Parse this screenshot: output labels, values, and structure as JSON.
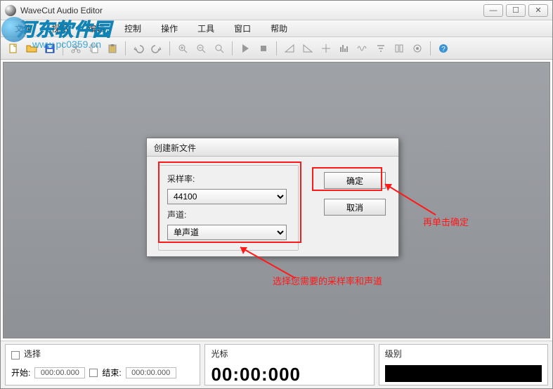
{
  "title": "WaveCut Audio Editor",
  "watermark": {
    "brand_a": "河东",
    "brand_b": "软件园",
    "url": "www.pc0359.cn"
  },
  "menu": [
    "文件",
    "视图",
    "编辑",
    "控制",
    "操作",
    "工具",
    "窗口",
    "帮助"
  ],
  "dialog": {
    "title": "创建新文件",
    "sample_rate_label": "采样率:",
    "sample_rate_value": "44100",
    "channel_label": "声道:",
    "channel_value": "单声道",
    "ok": "确定",
    "cancel": "取消"
  },
  "status": {
    "select_label": "选择",
    "start_label": "开始:",
    "start_value": "000:00.000",
    "end_label": "结束:",
    "end_value": "000:00.000",
    "cursor_label": "光标",
    "cursor_value": "00:00:000",
    "level_label": "级别"
  },
  "annotations": {
    "select_hint": "选择您需要的采样率和声道",
    "ok_hint": "再单击确定"
  },
  "win_buttons": {
    "min": "—",
    "max": "☐",
    "close": "✕"
  }
}
